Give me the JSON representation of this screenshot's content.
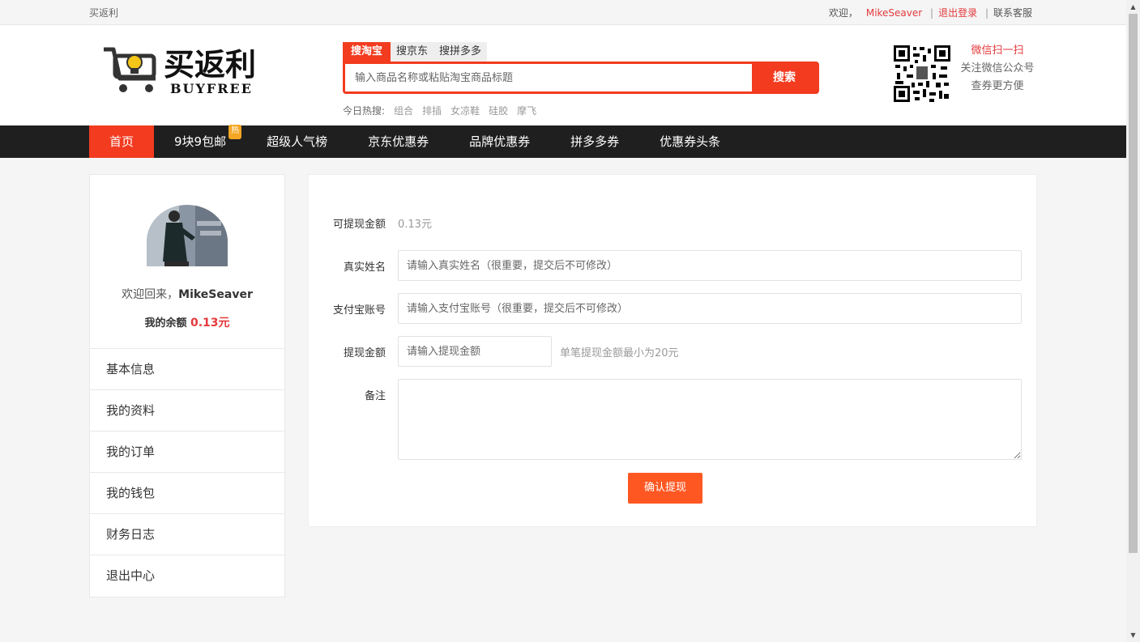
{
  "topbar": {
    "site_name": "买返利",
    "welcome": "欢迎，",
    "username": "MikeSeaver",
    "separator": "|",
    "logout": "退出登录",
    "contact": "联系客服"
  },
  "header": {
    "logo_main": "买返利",
    "logo_sub": "BUYFREE",
    "search_tabs": [
      "搜淘宝",
      "搜京东",
      "搜拼多多"
    ],
    "search_placeholder": "输入商品名称或粘贴淘宝商品标题",
    "search_button": "搜索",
    "hot_label": "今日热搜:",
    "hot_keywords": [
      "组合",
      "排插",
      "女凉鞋",
      "硅胶",
      "摩飞"
    ],
    "wechat_line1": "微信扫一扫",
    "wechat_line2": "关注微信公众号",
    "wechat_line3": "查券更方便",
    "brand_color": "#f23b1f"
  },
  "nav": {
    "items": [
      "首页",
      "9块9包邮",
      "超级人气榜",
      "京东优惠券",
      "品牌优惠券",
      "拼多多券",
      "优惠券头条"
    ],
    "badge": "热"
  },
  "side": {
    "welcome_prefix": "欢迎回来，",
    "username": "MikeSeaver",
    "balance_label": "我的余额",
    "balance_value": "0.13元",
    "menu": [
      "基本信息",
      "我的资料",
      "我的订单",
      "我的钱包",
      "财务日志",
      "退出中心"
    ]
  },
  "form": {
    "available_label": "可提现金额",
    "available_value": "0.13元",
    "name_label": "真实姓名",
    "name_placeholder": "请输入真实姓名（很重要，提交后不可修改）",
    "alipay_label": "支付宝账号",
    "alipay_placeholder": "请输入支付宝账号（很重要，提交后不可修改）",
    "amount_label": "提现金额",
    "amount_placeholder": "请输入提现金额",
    "amount_hint": "单笔提现金额最小为20元",
    "note_label": "备注",
    "submit": "确认提现",
    "submit_color": "#ff5722"
  }
}
